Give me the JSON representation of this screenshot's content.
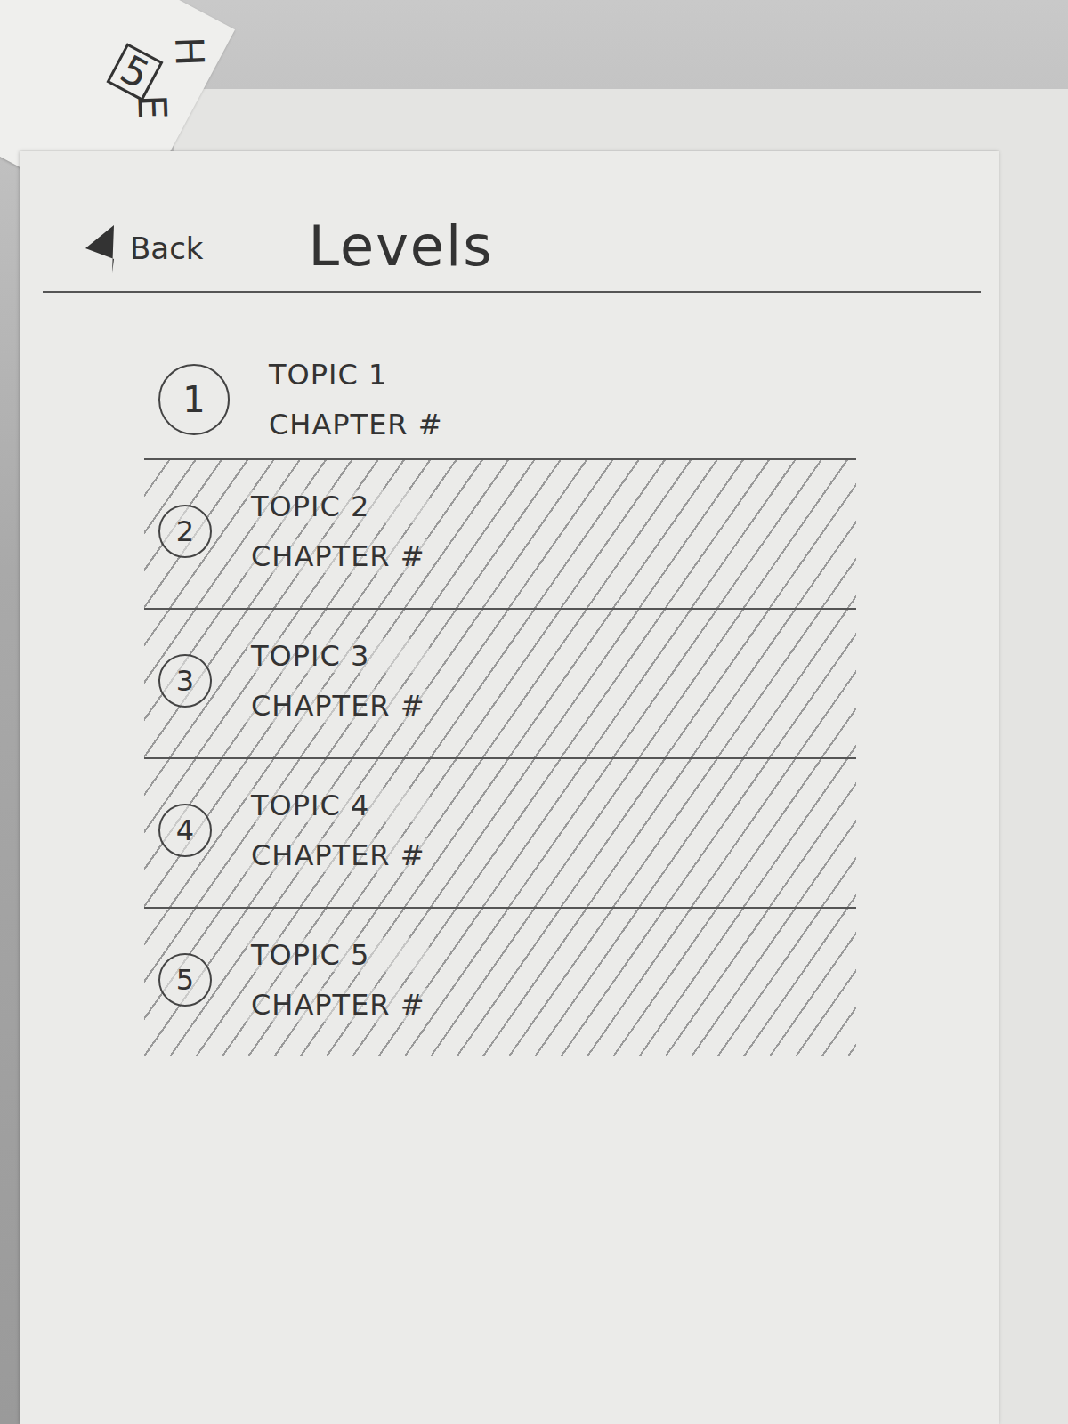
{
  "scrap": {
    "letters": [
      "5",
      "H",
      "E"
    ]
  },
  "header": {
    "back": "Back",
    "title": "Levels"
  },
  "levels": [
    {
      "number": "1",
      "topic": "TOPIC 1",
      "chapter": "CHAPTER #",
      "locked": false
    },
    {
      "number": "2",
      "topic": "TOPIC 2",
      "chapter": "CHAPTER #",
      "locked": true
    },
    {
      "number": "3",
      "topic": "TOPIC 3",
      "chapter": "CHAPTER #",
      "locked": true
    },
    {
      "number": "4",
      "topic": "TOPIC 4",
      "chapter": "CHAPTER #",
      "locked": true
    },
    {
      "number": "5",
      "topic": "TOPIC 5",
      "chapter": "CHAPTER #",
      "locked": true
    }
  ]
}
